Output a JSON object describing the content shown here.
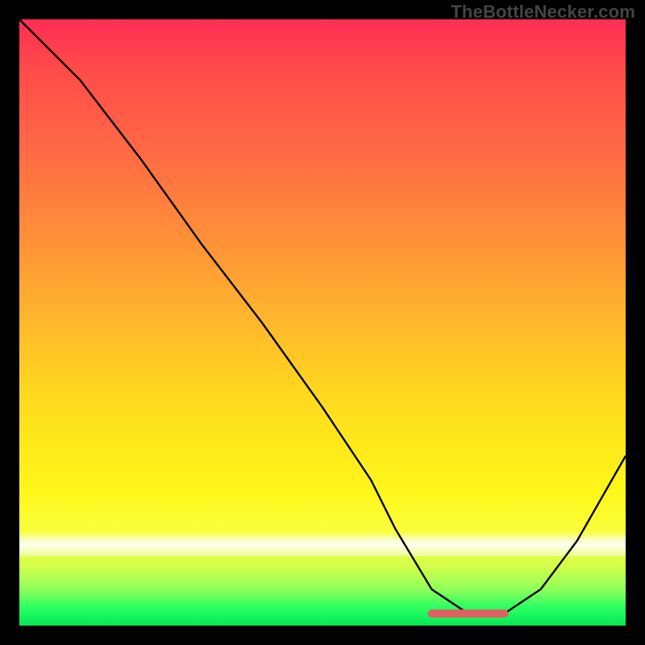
{
  "watermark": "TheBottleNecker.com",
  "chart_data": {
    "type": "line",
    "title": "",
    "xlabel": "",
    "ylabel": "",
    "xlim": [
      0,
      100
    ],
    "ylim": [
      0,
      100
    ],
    "series": [
      {
        "name": "bottleneck-curve",
        "x": [
          0,
          4,
          10,
          20,
          30,
          40,
          50,
          58,
          62,
          68,
          74,
          80,
          86,
          92,
          100
        ],
        "y": [
          100,
          96,
          90,
          77,
          63,
          50,
          36,
          24,
          16,
          6,
          2,
          2,
          6,
          14,
          28
        ]
      }
    ],
    "highlight_segment": {
      "name": "optimal-range",
      "x": [
        68,
        80
      ],
      "y": [
        2,
        2
      ]
    },
    "gradient_stops": [
      {
        "pos": 0,
        "color": "#ff2d55"
      },
      {
        "pos": 50,
        "color": "#ffd420"
      },
      {
        "pos": 85,
        "color": "#ffffff"
      },
      {
        "pos": 100,
        "color": "#10f05a"
      }
    ]
  }
}
